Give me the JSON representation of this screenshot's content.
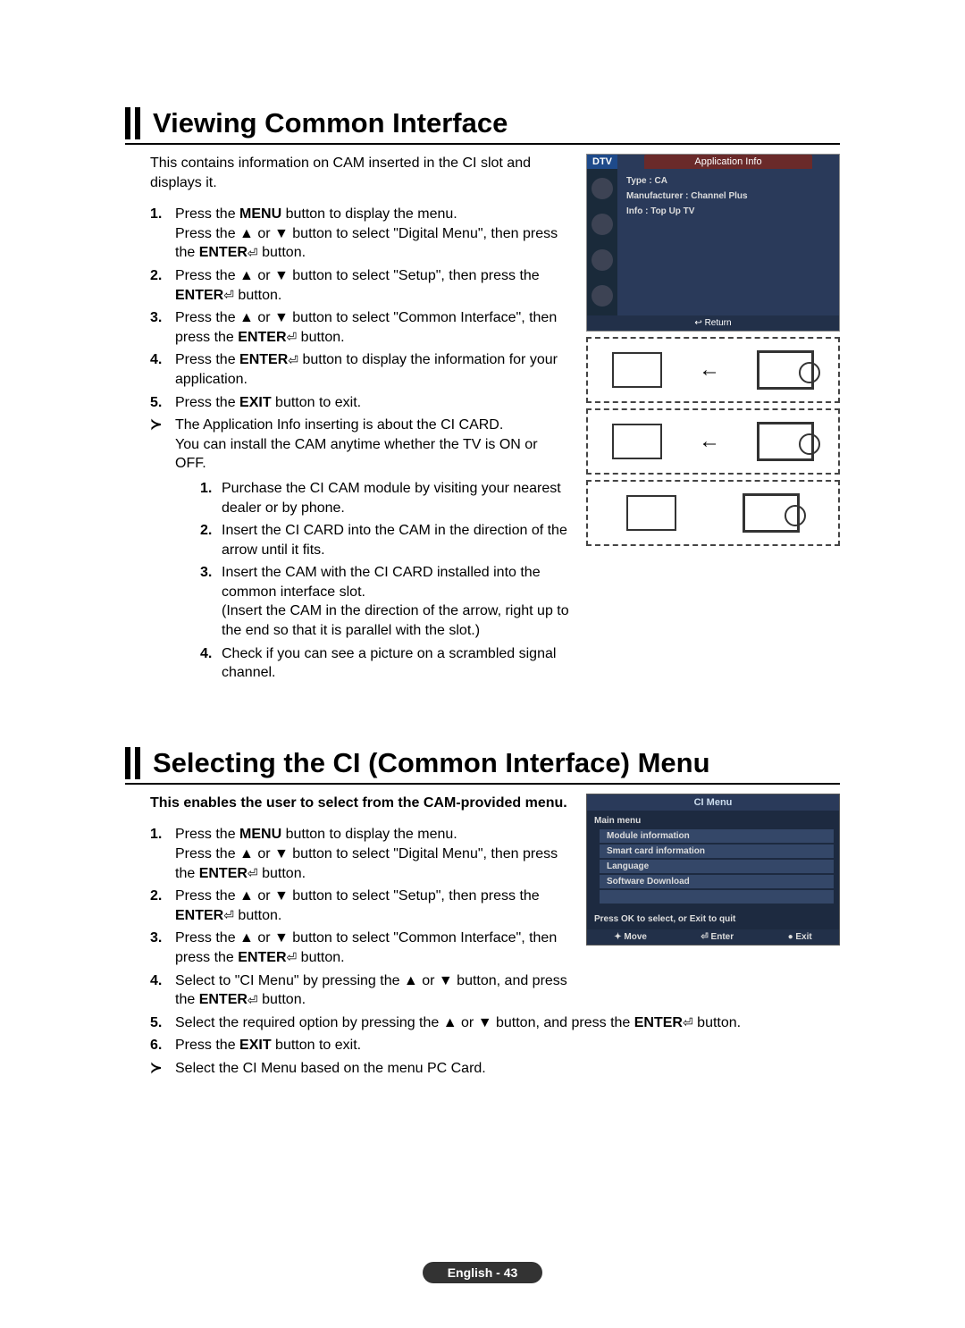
{
  "section1": {
    "title": "Viewing Common Interface",
    "intro": "This contains information on CAM inserted in the CI slot and displays it.",
    "steps": {
      "s1a": "Press the ",
      "s1_menu": "MENU",
      "s1b": " button to display the menu.",
      "s1c": "Press the ▲ or ▼ button to select \"Digital Menu\", then press the ",
      "s1_enter": "ENTER",
      "s1d": " button.",
      "s2a": "Press the ▲ or ▼ button to select \"Setup\", then press the ",
      "s2_enter": "ENTER",
      "s2b": " button.",
      "s3a": "Press the ▲ or ▼ button to select \"Common Interface\", then press the ",
      "s3_enter": "ENTER",
      "s3b": " button.",
      "s4a": "Press the ",
      "s4_enter": "ENTER",
      "s4b": " button to display the information for your application.",
      "s5a": "Press the ",
      "s5_exit": "EXIT",
      "s5b": " button to exit.",
      "note1": "The Application Info inserting is about the CI CARD.",
      "note2": "You can install the CAM anytime whether the TV is ON or OFF.",
      "sub1": "Purchase the CI CAM module by visiting your nearest dealer or by phone.",
      "sub2": "Insert the CI CARD into the CAM in the direction of the arrow until it fits.",
      "sub3a": "Insert the CAM with the CI CARD installed into the common interface slot.",
      "sub3b": "(Insert the CAM in the direction of the arrow, right up to the end so that it is parallel with the slot.)",
      "sub4": "Check if you can see a picture on a scrambled signal channel."
    },
    "osd": {
      "dtv": "DTV",
      "tab": "Application Info",
      "type": "Type : CA",
      "manufacturer": "Manufacturer : Channel Plus",
      "info": "Info : Top Up TV",
      "return": "↩ Return"
    }
  },
  "section2": {
    "title": "Selecting the CI (Common Interface) Menu",
    "intro": "This enables the user to select from the CAM-provided menu.",
    "steps": {
      "s1a": "Press the ",
      "s1_menu": "MENU",
      "s1b": " button to display the menu.",
      "s1c": "Press the ▲ or ▼ button to select \"Digital Menu\", then press the ",
      "s1_enter": "ENTER",
      "s1d": " button.",
      "s2a": "Press the ▲ or ▼ button to select \"Setup\", then press the ",
      "s2_enter": "ENTER",
      "s2b": " button.",
      "s3a": "Press the ▲ or ▼ button to select \"Common Interface\", then press the ",
      "s3_enter": "ENTER",
      "s3b": " button.",
      "s4a": "Select to \"CI Menu\" by pressing the ▲ or ▼ button, and press the ",
      "s4_enter": "ENTER",
      "s4b": " button.",
      "s5a": "Select the required option by pressing the ▲ or ▼ button, and press the ",
      "s5_enter": "ENTER",
      "s5b": " button.",
      "s6a": "Press the ",
      "s6_exit": "EXIT",
      "s6b": " button to exit.",
      "note": "Select the CI Menu based on the menu PC Card."
    },
    "osd": {
      "title": "CI Menu",
      "main": "Main menu",
      "items": [
        "Module information",
        "Smart card information",
        "Language",
        "Software Download"
      ],
      "hint": "Press OK to select, or Exit to quit",
      "move": "✦ Move",
      "enter": "⏎ Enter",
      "exit": "● Exit"
    }
  },
  "footer": "English - 43"
}
